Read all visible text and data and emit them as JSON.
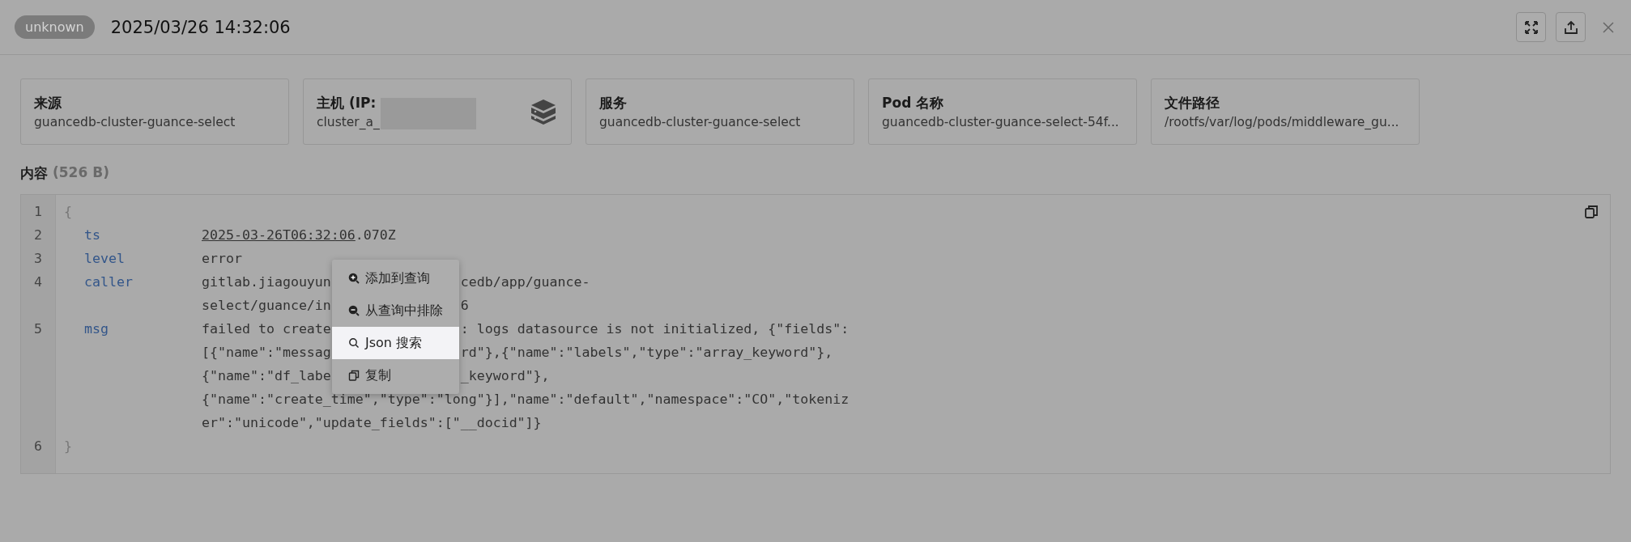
{
  "header": {
    "level_badge": "unknown",
    "time": "2025/03/26 14:32:06"
  },
  "cards": [
    {
      "title": "来源",
      "value": "guancedb-cluster-guance-select"
    },
    {
      "title": "主机 (IP:",
      "value": "cluster_a_",
      "redacted": true,
      "icon": true
    },
    {
      "title": "服务",
      "value": "guancedb-cluster-guance-select"
    },
    {
      "title": "Pod 名称",
      "value": "guancedb-cluster-guance-select-54f..."
    },
    {
      "title": "文件路径",
      "value": "/rootfs/var/log/pods/middleware_gu..."
    }
  ],
  "content": {
    "title": "内容",
    "size": "(526 B)"
  },
  "code": [
    {
      "number": "1",
      "kind": "brace",
      "text": "{"
    },
    {
      "number": "2",
      "kind": "field",
      "key": "ts",
      "lines": [
        [
          {
            "text": "2025-03-26T06:32:06",
            "underline": true
          },
          {
            "text": ".070Z"
          }
        ]
      ]
    },
    {
      "number": "3",
      "kind": "field",
      "key": "level",
      "lines": [
        [
          {
            "text": "error"
          }
        ]
      ]
    },
    {
      "number": "4",
      "kind": "field",
      "key": "caller",
      "lines": [
        [
          {
            "text": "gitlab.jiagouyun"
          },
          {
            "text": "cedb/app/guance-",
            "gap_before": true
          }
        ],
        [
          {
            "text": "select/guance/in"
          },
          {
            "text": "6",
            "gap_before": true
          }
        ]
      ]
    },
    {
      "number": "5",
      "kind": "field",
      "key": "msg",
      "lines": [
        [
          {
            "text": "failed to create"
          },
          {
            "text": ": logs datasource is not initialized, {\"fields\":",
            "gap_before": true
          }
        ],
        [
          {
            "text": "[{\"name\":\"messag"
          },
          {
            "text": "rd\"},{\"name\":\"labels\",\"type\":\"array_keyword\"},",
            "gap_before": true
          }
        ],
        [
          {
            "text": "{\"name\":\"df_labe"
          },
          {
            "text": "_keyword\"},",
            "gap_before": true
          }
        ],
        [
          {
            "text": "{\"name\":\"create_time\",\"type\":\"long\"}],\"name\":\"default\",\"namespace\":\"CO\",\"tokeniz"
          }
        ],
        [
          {
            "text": "er\":\"unicode\",\"update_fields\":[\"__docid\"]}"
          }
        ]
      ]
    },
    {
      "number": "6",
      "kind": "brace",
      "text": "}"
    }
  ],
  "context_menu": [
    {
      "kind": "add",
      "label": "添加到查询",
      "selected": false
    },
    {
      "kind": "exclude",
      "label": "从查询中排除",
      "selected": false
    },
    {
      "kind": "search",
      "label": "Json 搜索",
      "selected": true
    },
    {
      "kind": "copy",
      "label": "复制",
      "selected": false
    }
  ]
}
